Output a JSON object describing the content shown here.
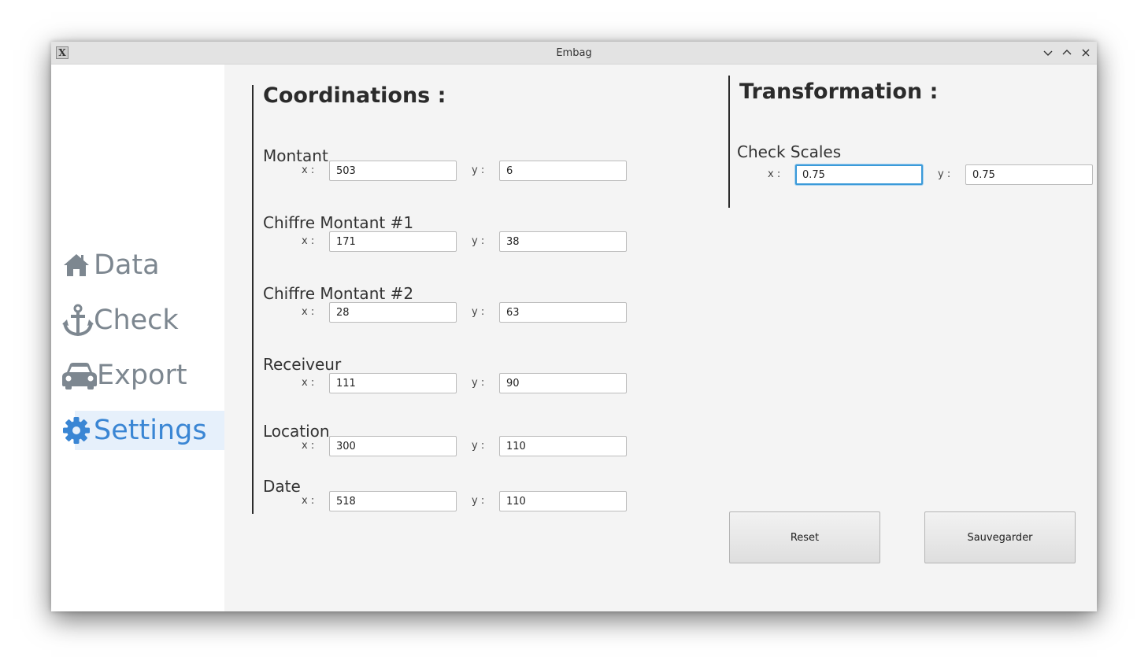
{
  "window": {
    "title": "Embag",
    "app_icon_glyph": "X"
  },
  "sidebar": {
    "items": [
      {
        "label": "Data",
        "icon": "home-icon",
        "active": false
      },
      {
        "label": "Check",
        "icon": "anchor-icon",
        "active": false
      },
      {
        "label": "Export",
        "icon": "car-icon",
        "active": false
      },
      {
        "label": "Settings",
        "icon": "gear-icon",
        "active": true
      }
    ]
  },
  "coordinations": {
    "title": "Coordinations :",
    "x_label": "x :",
    "y_label": "y :",
    "fields": [
      {
        "label": "Montant",
        "x": "503",
        "y": "6"
      },
      {
        "label": "Chiffre Montant #1",
        "x": "171",
        "y": "38"
      },
      {
        "label": "Chiffre Montant #2",
        "x": "28",
        "y": "63"
      },
      {
        "label": "Receiveur",
        "x": "111",
        "y": "90"
      },
      {
        "label": "Location",
        "x": "300",
        "y": "110"
      },
      {
        "label": "Date",
        "x": "518",
        "y": "110"
      }
    ]
  },
  "transformation": {
    "title": "Transformation :",
    "check_scales": {
      "label": "Check Scales",
      "x_label": "x :",
      "y_label": "y :",
      "x": "0.75",
      "y": "0.75"
    }
  },
  "buttons": {
    "reset_label": "Reset",
    "save_label": "Sauvegarder"
  },
  "colors": {
    "accent": "#3a86d4",
    "nav_inactive": "#7d8790",
    "active_bg": "#e6f0fb"
  }
}
